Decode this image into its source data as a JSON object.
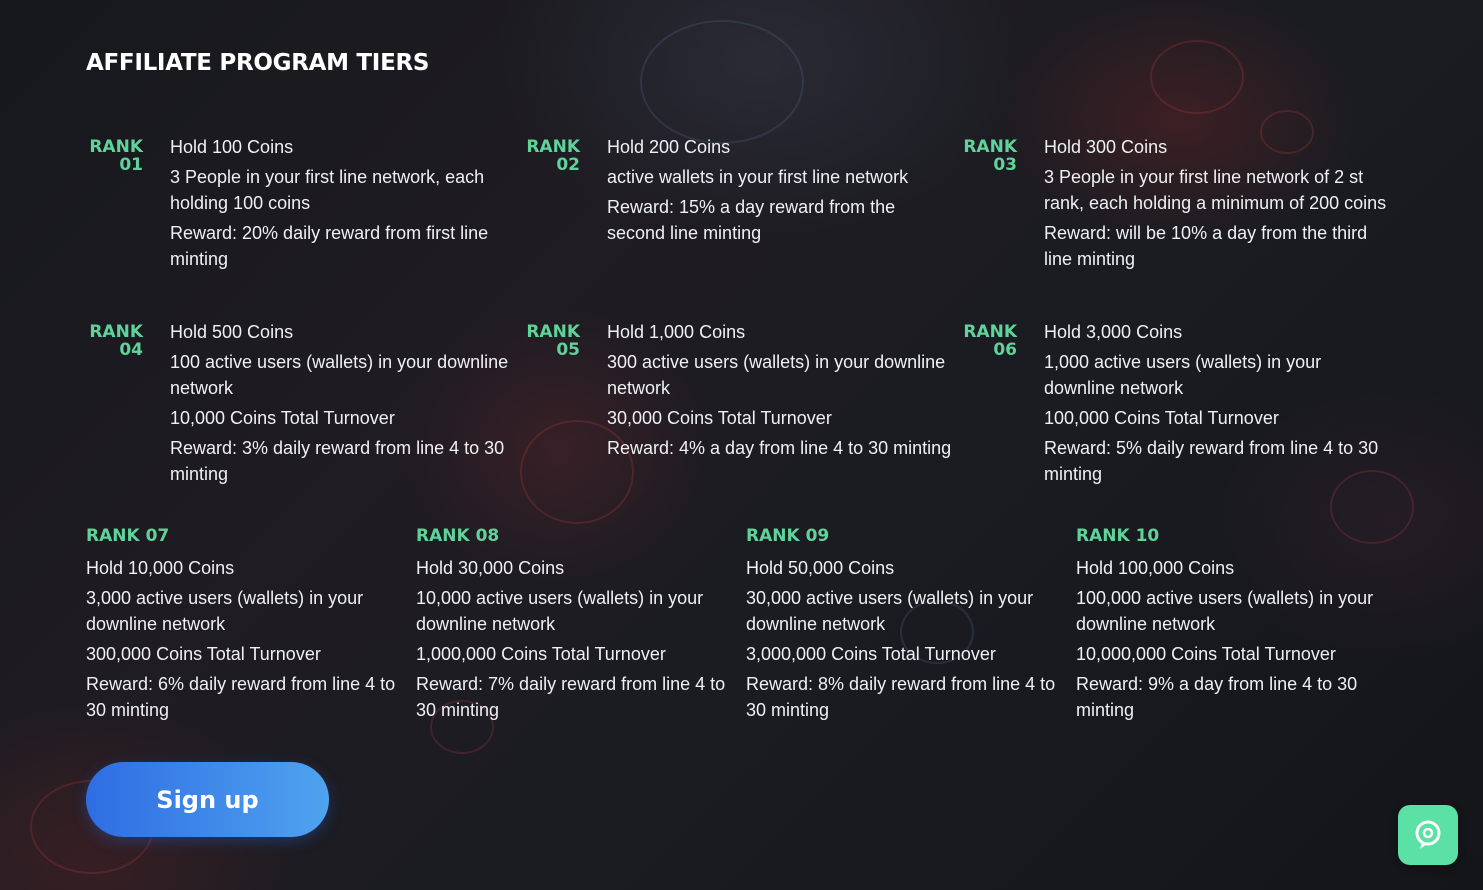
{
  "page": {
    "title": "AFFILIATE PROGRAM TIERS"
  },
  "tiers_top": [
    {
      "rank_word": "RANK",
      "rank_num": "01",
      "lines": [
        "Hold 100 Coins",
        "3 People in your first line network, each holding 100 coins",
        "Reward: 20% daily reward from first line minting"
      ]
    },
    {
      "rank_word": "RANK",
      "rank_num": "02",
      "lines": [
        "Hold 200 Coins",
        "active wallets in your first line network",
        "Reward: 15% a day reward from the second line minting"
      ]
    },
    {
      "rank_word": "RANK",
      "rank_num": "03",
      "lines": [
        "Hold 300 Coins",
        "3 People in your first line network of 2 st rank, each holding a minimum of 200 coins",
        "Reward: will be 10% a day from the third line minting"
      ]
    },
    {
      "rank_word": "RANK",
      "rank_num": "04",
      "lines": [
        "Hold 500 Coins",
        "100 active users (wallets) in your downline network",
        "10,000 Coins Total Turnover",
        "Reward: 3% daily reward from line 4 to 30 minting"
      ]
    },
    {
      "rank_word": "RANK",
      "rank_num": "05",
      "lines": [
        "Hold 1,000 Coins",
        "300 active users (wallets) in your downline network",
        "30,000 Coins Total Turnover",
        "Reward: 4% a day from line 4 to 30 minting"
      ]
    },
    {
      "rank_word": "RANK",
      "rank_num": "06",
      "lines": [
        "Hold 3,000 Coins",
        "1,000 active users (wallets) in your downline network",
        "100,000 Coins Total Turnover",
        "Reward: 5% daily reward from line 4 to 30 minting"
      ]
    }
  ],
  "tiers_bottom": [
    {
      "rank": "RANK 07",
      "lines": [
        "Hold 10,000 Coins",
        "3,000 active users (wallets) in your downline network",
        "300,000 Coins Total Turnover",
        "Reward: 6% daily reward from line 4 to 30 minting"
      ]
    },
    {
      "rank": "RANK 08",
      "lines": [
        "Hold 30,000 Coins",
        "10,000 active users (wallets) in your downline network",
        "1,000,000 Coins Total Turnover",
        "Reward: 7% daily reward from line 4 to 30 minting"
      ]
    },
    {
      "rank": "RANK 09",
      "lines": [
        "Hold 50,000 Coins",
        "30,000 active users (wallets) in your downline network",
        "3,000,000 Coins Total Turnover",
        "Reward: 8% daily reward from line 4 to 30 minting"
      ]
    },
    {
      "rank": "RANK 10",
      "lines": [
        "Hold 100,000 Coins",
        "100,000 active users (wallets) in your downline network",
        "10,000,000 Coins Total Turnover",
        "Reward: 9% a day from line 4 to 30 minting"
      ]
    }
  ],
  "cta": {
    "signup_label": "Sign up"
  },
  "chat_widget": {
    "icon": "chat-bubble-icon"
  },
  "colors": {
    "accent_green": "#5fd39a",
    "button_gradient_start": "#2e6de3",
    "button_gradient_end": "#4fa3ef",
    "chat_bg": "#5be0a6"
  }
}
